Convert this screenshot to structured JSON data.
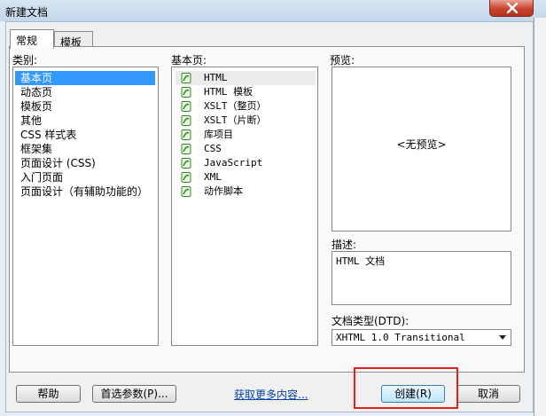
{
  "window": {
    "title": "新建文档"
  },
  "tabs": [
    {
      "label": "常规",
      "active": true
    },
    {
      "label": "模板",
      "active": false
    }
  ],
  "category": {
    "label": "类别:",
    "items": [
      "基本页",
      "动态页",
      "模板页",
      "其他",
      "CSS 样式表",
      "框架集",
      "页面设计 (CSS)",
      "入门页面",
      "页面设计（有辅助功能的）"
    ],
    "selected": "基本页"
  },
  "basic_pages": {
    "label": "基本页:",
    "items": [
      "HTML",
      "HTML 模板",
      "XSLT（整页）",
      "XSLT（片断）",
      "库项目",
      "CSS",
      "JavaScript",
      "XML",
      "动作脚本"
    ],
    "selected": "HTML",
    "icon": "green-document-icon"
  },
  "preview": {
    "label": "预览:",
    "placeholder": "<无预览>"
  },
  "description": {
    "label": "描述:",
    "text": "HTML 文档"
  },
  "doctype": {
    "label": "文档类型(DTD):",
    "value": "XHTML 1.0 Transitional"
  },
  "footer": {
    "help_label": "帮助",
    "preferences_label": "首选参数(P)...",
    "more_content_label": "获取更多内容...",
    "create_label": "创建(R)",
    "cancel_label": "取消"
  },
  "colors": {
    "selection": "#3399ff",
    "highlight_box": "#e0211d",
    "link": "#0645ad"
  }
}
